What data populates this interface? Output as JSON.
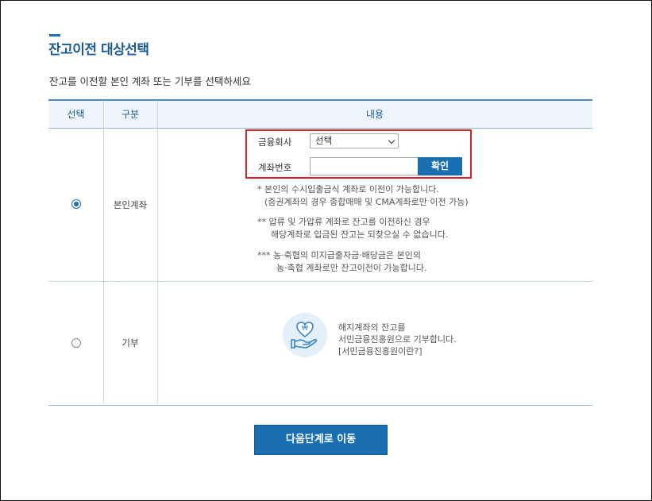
{
  "page": {
    "title": "잔고이전 대상선택",
    "subtitle": "잔고를 이전할 본인 계좌 또는 기부를 선택하세요"
  },
  "table": {
    "headers": [
      "선택",
      "구분",
      "내용"
    ],
    "rows": [
      {
        "category": "본인계좌",
        "selected": true,
        "form": {
          "company_label": "금융회사",
          "company_selected": "선택",
          "account_label": "계좌번호",
          "account_value": "",
          "confirm_label": "확인"
        },
        "notes": [
          "* 본인의 수시입출금식 계좌로 이전이 가능합니다.",
          "(증권계좌의 경우 종합매매 및 CMA계좌로만 이전 가능)",
          "** 압류 및 가압류 계좌로 잔고를 이전하신 경우",
          "해당계좌로 입금된 잔고는 되찾으실 수 없습니다.",
          "*** 농·축협의 미지급출자금·배당금은 본인의",
          "농·축협 계좌로만 잔고이전이 가능합니다."
        ]
      },
      {
        "category": "기부",
        "selected": false,
        "icon": "hand-coin-heart-icon",
        "lines": [
          "해지계좌의 잔고를",
          "서민금융진흥원으로 기부합니다."
        ],
        "link": "[서민금융진흥원이란?]"
      }
    ]
  },
  "actions": {
    "next_label": "다음단계로 이동"
  },
  "colors": {
    "accent": "#1a6fb3",
    "title": "#1a5a96",
    "highlight_border": "#d2232a",
    "header_bg": "#eef4fa"
  }
}
